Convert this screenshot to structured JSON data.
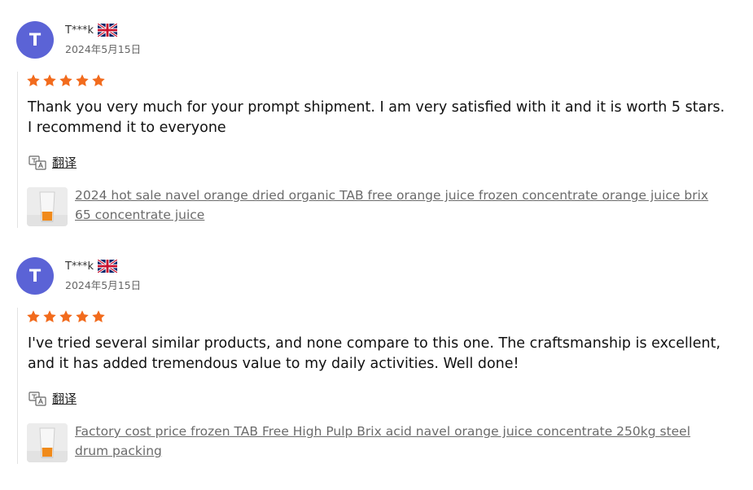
{
  "reviews": [
    {
      "avatar_letter": "T",
      "username": "T***k",
      "country_flag": "uk-flag-icon",
      "date": "2024年5月15日",
      "rating": 5,
      "text": "Thank you very much for your prompt shipment. I am very satisfied with it and it is worth 5 stars. I recommend it to everyone",
      "translate_label": "翻译",
      "product_title": "2024 hot sale navel orange dried organic TAB free orange juice frozen concentrate orange juice brix 65 concentrate juice"
    },
    {
      "avatar_letter": "T",
      "username": "T***k",
      "country_flag": "uk-flag-icon",
      "date": "2024年5月15日",
      "rating": 5,
      "text": "I've tried several similar products, and none compare to this one. The craftsmanship is excellent, and it has added tremendous value to my daily activities. Well done!",
      "translate_label": "翻译",
      "product_title": "Factory cost price frozen TAB Free High Pulp Brix acid navel orange juice concentrate 250kg steel drum packing"
    }
  ],
  "colors": {
    "avatar": "#5b63d6",
    "star": "#f26b1d",
    "link": "#6b6b6b"
  }
}
